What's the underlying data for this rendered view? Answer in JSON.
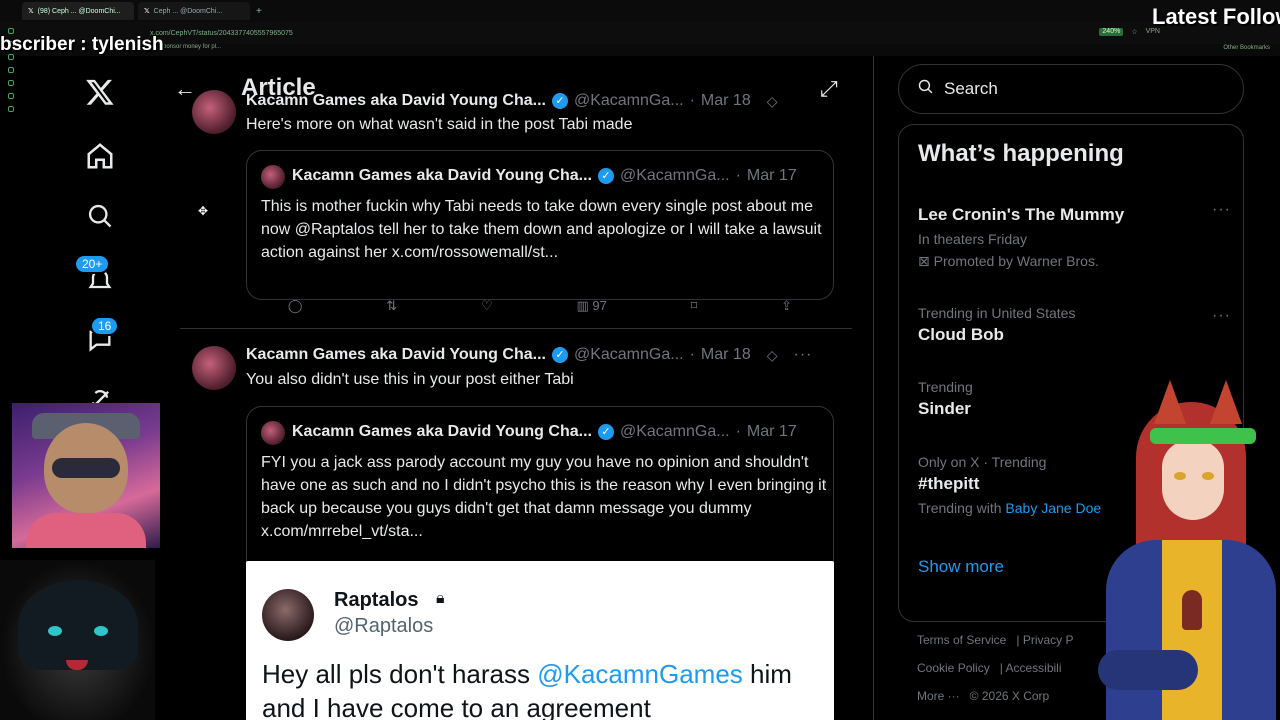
{
  "browser": {
    "tabs": [
      {
        "label": "(98) Ceph ... @DoomChi...",
        "active": true
      },
      {
        "label": "Ceph ... @DoomChi...",
        "active": false
      }
    ],
    "new_tab": "+",
    "url": "x.com/CephVT/status/2043377405557965075",
    "zoom": "240%",
    "vpn": "VPN",
    "bookmark_hint": "sponsor money for pl...",
    "other_bookmarks": "Other Bookmarks"
  },
  "overlays": {
    "subscriber": "bscriber : tylenish",
    "latest_follower": "Latest Followe"
  },
  "nav": {
    "notifications_badge": "20+",
    "messages_badge": "16"
  },
  "header": {
    "title": "Article"
  },
  "tweets": [
    {
      "name": "Kacamn Games aka David Young Cha...",
      "handle": "@KacamnGa...",
      "date": "Mar 18",
      "text": "Here's more on what wasn't said in the post Tabi made",
      "quote": {
        "name": "Kacamn Games aka David Young Cha...",
        "handle": "@KacamnGa...",
        "date": "Mar 17",
        "text": "This is mother fuckin why Tabi needs to take down every single post about me now @Raptalos tell her to take them down and apologize or I will take a lawsuit action against her x.com/rossowemall/st...",
        "views": "97"
      }
    },
    {
      "name": "Kacamn Games aka David Young Cha...",
      "handle": "@KacamnGa...",
      "date": "Mar 18",
      "text": "You also didn't use this in your post either Tabi",
      "quote": {
        "name": "Kacamn Games aka David Young Cha...",
        "handle": "@KacamnGa...",
        "date": "Mar 17",
        "text": "FYI you a jack ass parody account my guy you have no opinion and shouldn't have one as such and no I didn't psycho this is the reason why I even bringing it back up because you guys didn't get that damn message you dummy  x.com/mrrebel_vt/sta..."
      }
    }
  ],
  "embedded": {
    "name": "Raptalos",
    "handle": "@Raptalos",
    "text_before": "Hey all pls don't harass ",
    "mention": "@KacamnGames",
    "text_after": " him and I have come to an agreement"
  },
  "sidebar": {
    "search_placeholder": "Search",
    "happening_title": "What’s happening",
    "trends": [
      {
        "meta": "",
        "title": "Lee Cronin's The Mummy",
        "sub": "In theaters Friday",
        "sub2": "Promoted by Warner Bros."
      },
      {
        "meta": "Trending in United States",
        "title": "Cloud Bob"
      },
      {
        "meta": "Trending",
        "title": "Sinder"
      },
      {
        "meta": "Only on X · Trending",
        "title": "#thepitt",
        "with_label": "Trending with",
        "with_link": "Baby Jane Doe"
      }
    ],
    "show_more": "Show more",
    "footer": {
      "terms": "Terms of Service",
      "privacy": "Privacy P",
      "cookie": "Cookie Policy",
      "accessibility": "Accessibili",
      "more": "More ···",
      "copyright": "© 2026 X Corp"
    }
  },
  "colors": {
    "accent": "#1d9bf0",
    "background": "#000000",
    "border": "#2f3336",
    "muted": "#71767b"
  }
}
